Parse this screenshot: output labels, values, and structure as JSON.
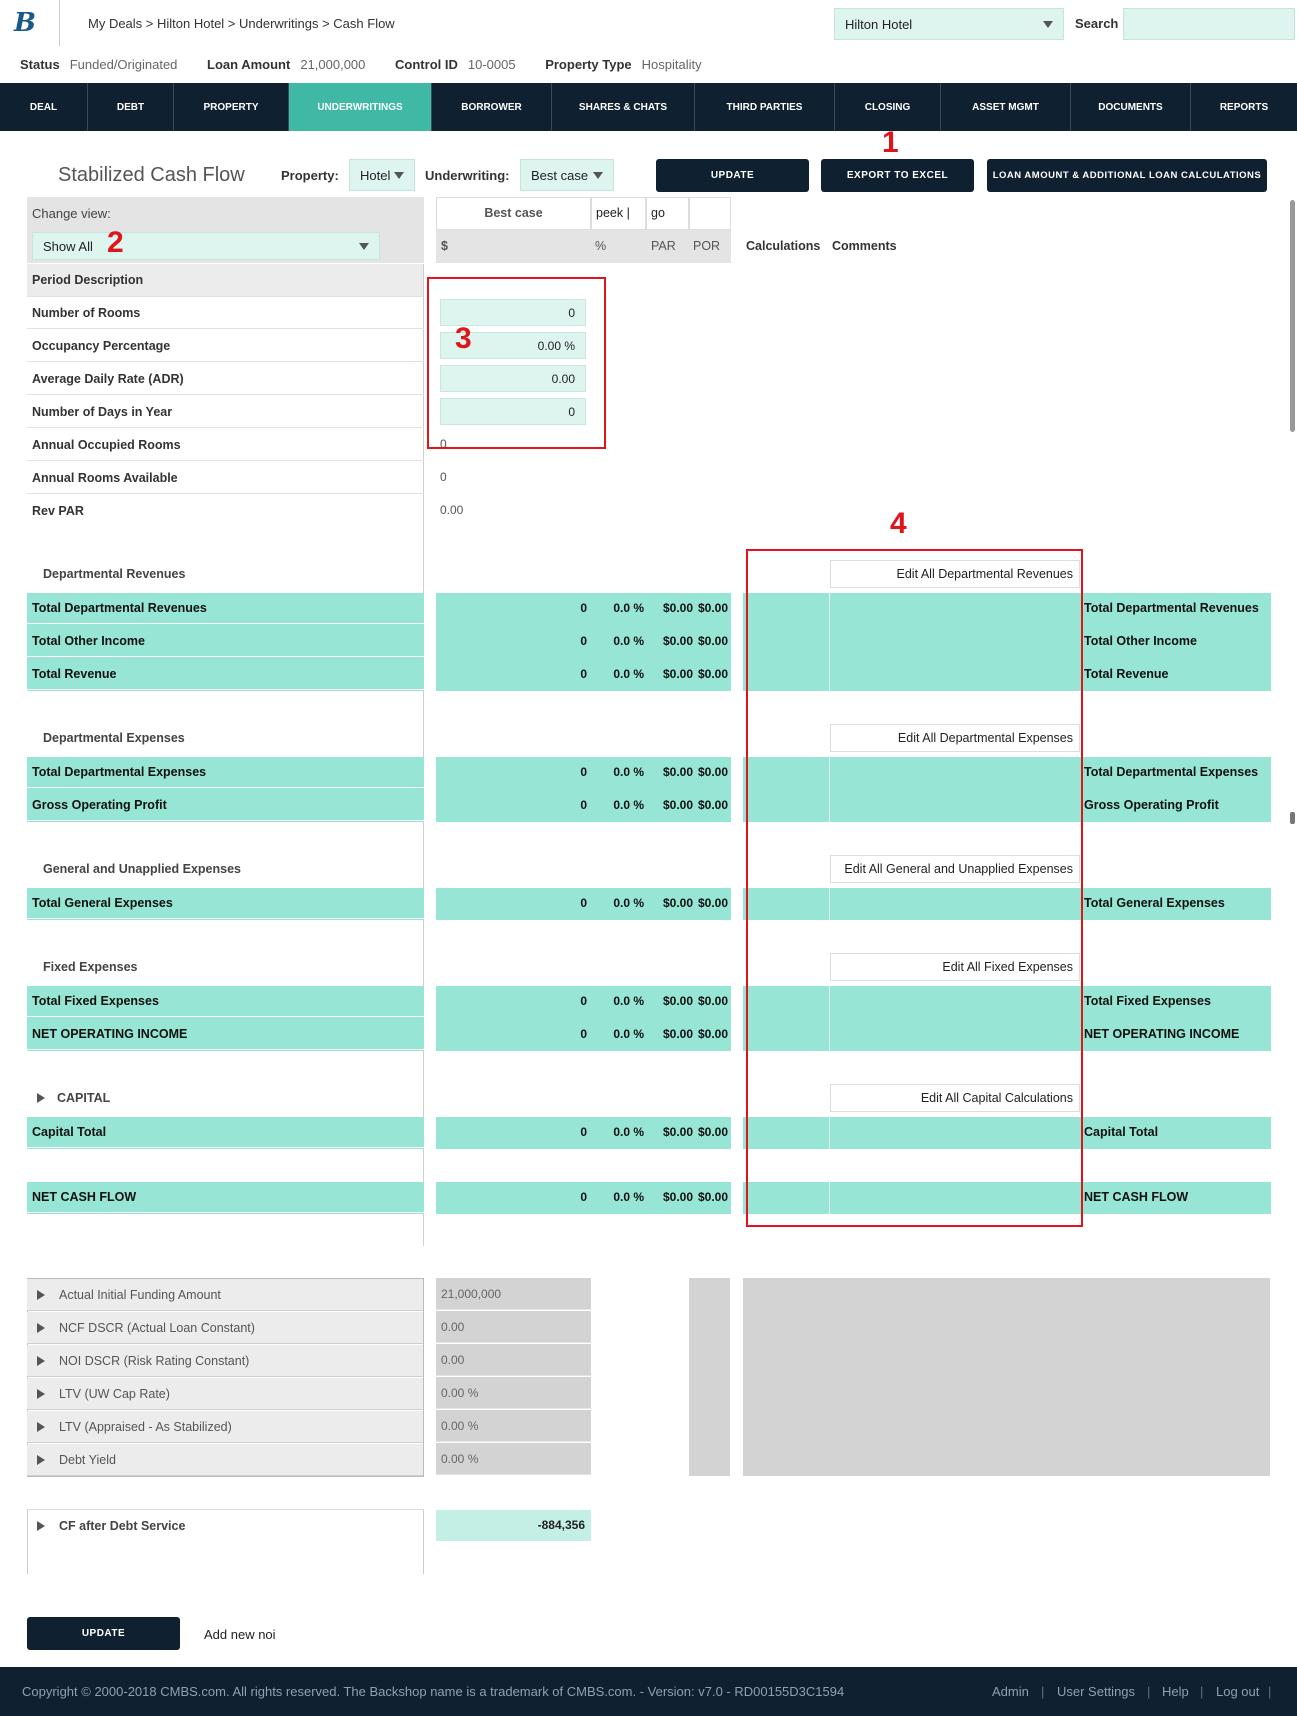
{
  "header": {
    "logo": "B",
    "breadcrumb": "My Deals > Hilton Hotel > Underwritings > Cash Flow",
    "deal_select": "Hilton Hotel",
    "search_label": "Search",
    "search_placeholder": ""
  },
  "status_bar": [
    {
      "label": "Status",
      "value": "Funded/Originated"
    },
    {
      "label": "Loan Amount",
      "value": "21,000,000"
    },
    {
      "label": "Control ID",
      "value": "10-0005"
    },
    {
      "label": "Property Type",
      "value": "Hospitality"
    }
  ],
  "nav": [
    "DEAL",
    "DEBT",
    "PROPERTY",
    "UNDERWRITINGS",
    "BORROWER",
    "SHARES & CHATS",
    "THIRD PARTIES",
    "CLOSING",
    "ASSET MGMT",
    "DOCUMENTS",
    "REPORTS"
  ],
  "nav_active": "UNDERWRITINGS",
  "toolbar": {
    "title": "Stabilized Cash Flow",
    "property_label": "Property:",
    "property_value": "Hotel",
    "underwriting_label": "Underwriting:",
    "underwriting_value": "Best case",
    "update_btn": "UPDATE",
    "export_btn": "EXPORT TO EXCEL",
    "loan_btn": "LOAN AMOUNT & ADDITIONAL LOAN CALCULATIONS"
  },
  "grid_head": {
    "change_view": "Change view:",
    "view_value": "Show All",
    "best_case": "Best case",
    "peek": "peek |",
    "go": "go",
    "dollar": "$",
    "pct": "%",
    "par": "PAR",
    "por": "POR",
    "calculations": "Calculations",
    "comments": "Comments",
    "period_desc": "Period Description"
  },
  "inputs": [
    {
      "label": "Number of Rooms",
      "value": "0"
    },
    {
      "label": "Occupancy Percentage",
      "value": "0.00 %"
    },
    {
      "label": "Average Daily Rate (ADR)",
      "value": "0.00"
    },
    {
      "label": "Number of Days in Year",
      "value": "0"
    }
  ],
  "computed": [
    {
      "label": "Annual Occupied Rooms",
      "value": "0"
    },
    {
      "label": "Annual Rooms Available",
      "value": "0"
    },
    {
      "label": "Rev PAR",
      "value": "0.00"
    }
  ],
  "sections": {
    "dept_rev": "Departmental Revenues",
    "dept_rev_edit": "Edit All Departmental Revenues",
    "dept_exp": "Departmental Expenses",
    "dept_exp_edit": "Edit All Departmental Expenses",
    "gen_exp": "General and Unapplied Expenses",
    "gen_exp_edit": "Edit All General and Unapplied Expenses",
    "fixed_exp": "Fixed Expenses",
    "fixed_exp_edit": "Edit All Fixed Expenses",
    "capital": "CAPITAL",
    "capital_edit": "Edit All Capital Calculations"
  },
  "totals": [
    {
      "label": "Total Departmental Revenues",
      "v": "0",
      "pct": "0.0 %",
      "par": "$0.00",
      "por": "$0.00"
    },
    {
      "label": "Total Other Income",
      "v": "0",
      "pct": "0.0 %",
      "par": "$0.00",
      "por": "$0.00"
    },
    {
      "label": "Total Revenue",
      "v": "0",
      "pct": "0.0 %",
      "par": "$0.00",
      "por": "$0.00"
    },
    {
      "label": "Total Departmental Expenses",
      "v": "0",
      "pct": "0.0 %",
      "par": "$0.00",
      "por": "$0.00"
    },
    {
      "label": "Gross Operating Profit",
      "v": "0",
      "pct": "0.0 %",
      "par": "$0.00",
      "por": "$0.00"
    },
    {
      "label": "Total General Expenses",
      "v": "0",
      "pct": "0.0 %",
      "par": "$0.00",
      "por": "$0.00"
    },
    {
      "label": "Total Fixed Expenses",
      "v": "0",
      "pct": "0.0 %",
      "par": "$0.00",
      "por": "$0.00"
    },
    {
      "label": "NET OPERATING INCOME",
      "v": "0",
      "pct": "0.0 %",
      "par": "$0.00",
      "por": "$0.00"
    },
    {
      "label": "Capital Total",
      "v": "0",
      "pct": "0.0 %",
      "par": "$0.00",
      "por": "$0.00"
    },
    {
      "label": "NET CASH FLOW",
      "v": "0",
      "pct": "0.0 %",
      "par": "$0.00",
      "por": "$0.00"
    }
  ],
  "bottom": [
    {
      "label": "Actual Initial Funding Amount",
      "value": "21,000,000"
    },
    {
      "label": "NCF DSCR (Actual Loan Constant)",
      "value": "0.00"
    },
    {
      "label": "NOI DSCR (Risk Rating Constant)",
      "value": "0.00"
    },
    {
      "label": "LTV (UW Cap Rate)",
      "value": "0.00 %"
    },
    {
      "label": "LTV (Appraised - As Stabilized)",
      "value": "0.00 %"
    },
    {
      "label": "Debt Yield",
      "value": "0.00 %"
    }
  ],
  "cf_after": {
    "label": "CF after Debt Service",
    "value": "-884,356"
  },
  "bottom_actions": {
    "update": "UPDATE",
    "add_noi": "Add new noi"
  },
  "annotations": [
    "1",
    "2",
    "3",
    "4"
  ],
  "footer": {
    "copyright": "Copyright © 2000-2018 CMBS.com. All rights reserved. The Backshop name is a trademark of CMBS.com. - Version: v7.0 - RD00155D3C1594",
    "links": [
      "Admin",
      "User Settings",
      "Help",
      "Log out"
    ]
  }
}
